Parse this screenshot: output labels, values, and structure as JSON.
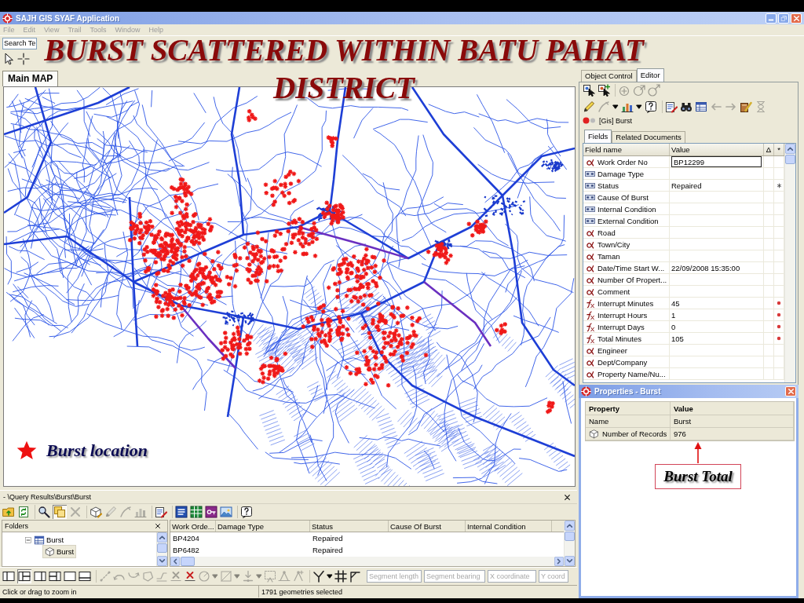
{
  "window": {
    "title": "SAJH GIS SYAF Application"
  },
  "menu": [
    "File",
    "Edit",
    "View",
    "Trail",
    "Tools",
    "Window",
    "Help"
  ],
  "toolbar": {
    "search": {
      "value": "Search Te"
    }
  },
  "slide_title": [
    "BURST SCATTERED WITHIN BATU PAHAT",
    "DISTRICT"
  ],
  "map_tabs": [
    {
      "label": "Main MAP",
      "selected": true
    }
  ],
  "map": {
    "legend": {
      "label": "Burst location"
    }
  },
  "side_panel": {
    "tabs": [
      {
        "label": "Object Control",
        "selected": false
      },
      {
        "label": "Editor",
        "selected": true
      }
    ],
    "toolbar_top": [
      [
        {
          "kind": "select",
          "disabled": false
        },
        {
          "kind": "select-add",
          "disabled": false
        }
      ],
      [
        {
          "kind": "point-add",
          "disabled": true
        },
        {
          "kind": "vertex-move",
          "disabled": true
        },
        {
          "kind": "node-link",
          "disabled": true
        }
      ]
    ],
    "toolbar_edit": [
      [
        {
          "kind": "pencil",
          "disabled": false
        },
        {
          "kind": "pen",
          "disabled": true
        },
        {
          "kind": "caret",
          "disabled": false
        },
        {
          "kind": "bar-chart",
          "disabled": false
        },
        {
          "kind": "caret",
          "disabled": false
        },
        {
          "kind": "help",
          "disabled": false
        }
      ],
      [
        {
          "kind": "form-edit",
          "disabled": false
        },
        {
          "kind": "binoculars",
          "disabled": false
        },
        {
          "kind": "table",
          "disabled": false
        },
        {
          "kind": "arrow-left",
          "disabled": true
        },
        {
          "kind": "arrow-right",
          "disabled": true
        },
        {
          "kind": "book-edit",
          "disabled": false
        },
        {
          "kind": "hourglass",
          "disabled": true
        }
      ]
    ],
    "layer": {
      "label": "[Gis] Burst",
      "active": true
    },
    "subtabs": [
      {
        "label": "Fields",
        "selected": true
      },
      {
        "label": "Related Documents",
        "selected": false
      }
    ],
    "columns": [
      "Field name",
      "Value",
      "Δ",
      "*"
    ],
    "rows": [
      {
        "kind": "text",
        "name": "Work Order No",
        "value": "BP12299",
        "editing": true,
        "required": false,
        "calculated": false
      },
      {
        "kind": "list",
        "name": "Damage Type",
        "editing": false,
        "required": false,
        "calculated": false
      },
      {
        "kind": "list",
        "name": "Status",
        "value": "Repaired",
        "editing": false,
        "required": true,
        "calculated": false
      },
      {
        "kind": "list",
        "name": "Cause Of Burst",
        "editing": false,
        "required": false,
        "calculated": false
      },
      {
        "kind": "list",
        "name": "Internal Condition",
        "editing": false,
        "required": false,
        "calculated": false
      },
      {
        "kind": "list",
        "name": "External Condition",
        "editing": false,
        "required": false,
        "calculated": false
      },
      {
        "kind": "text",
        "name": "Road",
        "editing": false,
        "required": false,
        "calculated": false
      },
      {
        "kind": "text",
        "name": "Town/City",
        "editing": false,
        "required": false,
        "calculated": false
      },
      {
        "kind": "text",
        "name": "Taman",
        "editing": false,
        "required": false,
        "calculated": false
      },
      {
        "kind": "text",
        "name": "Date/Time Start W...",
        "value": "22/09/2008 15:35:00",
        "editing": false,
        "required": false,
        "calculated": false
      },
      {
        "kind": "text",
        "name": "Number Of Propert...",
        "editing": false,
        "required": false,
        "calculated": false
      },
      {
        "kind": "text",
        "name": "Comment",
        "editing": false,
        "required": false,
        "calculated": false
      },
      {
        "kind": "formula",
        "name": "Interrupt Minutes",
        "value": "45",
        "editing": false,
        "required": false,
        "calculated": true
      },
      {
        "kind": "formula",
        "name": "Interrupt Hours",
        "value": "1",
        "editing": false,
        "required": false,
        "calculated": true
      },
      {
        "kind": "formula",
        "name": "Interrupt Days",
        "value": "0",
        "editing": false,
        "required": false,
        "calculated": true
      },
      {
        "kind": "formula",
        "name": "Total Minutes",
        "value": "105",
        "editing": false,
        "required": false,
        "calculated": true
      },
      {
        "kind": "text",
        "name": "Engineer",
        "editing": false,
        "required": false,
        "calculated": false
      },
      {
        "kind": "text",
        "name": "Dept/Company",
        "editing": false,
        "required": false,
        "calculated": false
      },
      {
        "kind": "text",
        "name": "Property Name/Nu...",
        "editing": false,
        "required": false,
        "calculated": false
      }
    ]
  },
  "properties": {
    "title": "Properties - Burst",
    "columns": [
      "Property",
      "Value"
    ],
    "rows": [
      {
        "kind": "plain",
        "name": "Name",
        "value": "Burst"
      },
      {
        "kind": "count",
        "name": "Number of Records",
        "value": "976"
      }
    ],
    "callout": "Burst Total"
  },
  "query_results": {
    "path": "- \\Query Results\\Burst\\Burst",
    "toolbar": [
      [
        {
          "kind": "folder-up",
          "pressed": false,
          "disabled": false
        },
        {
          "kind": "refresh",
          "pressed": false,
          "disabled": false
        }
      ],
      [
        {
          "kind": "search",
          "pressed": false,
          "disabled": false
        },
        {
          "kind": "copy",
          "pressed": true,
          "disabled": false
        },
        {
          "kind": "delete",
          "pressed": false,
          "disabled": true
        }
      ],
      [
        {
          "kind": "cube-edit",
          "pressed": false,
          "disabled": false
        },
        {
          "kind": "pencil",
          "pressed": false,
          "disabled": true
        },
        {
          "kind": "pen",
          "pressed": false,
          "disabled": true
        },
        {
          "kind": "bar-chart",
          "pressed": false,
          "disabled": true
        }
      ],
      [
        {
          "kind": "form-edit",
          "pressed": false,
          "disabled": false
        }
      ],
      [
        {
          "kind": "document",
          "pressed": false,
          "disabled": false
        },
        {
          "kind": "spreadsheet",
          "pressed": false,
          "disabled": false
        },
        {
          "kind": "database",
          "pressed": false,
          "disabled": false
        },
        {
          "kind": "picture",
          "pressed": false,
          "disabled": false
        }
      ],
      [
        {
          "kind": "help",
          "pressed": false,
          "disabled": false
        }
      ]
    ],
    "folders": {
      "title": "Folders",
      "tree": [
        {
          "kind": "table",
          "label": "Burst",
          "expanded": true,
          "selected": false,
          "children": [
            {
              "kind": "layer",
              "label": "Burst",
              "selected": true
            }
          ]
        }
      ]
    },
    "columns": [
      "Work Orde...",
      "Damage Type",
      "Status",
      "Cause Of Burst",
      "Internal Condition"
    ],
    "rows": [
      {
        "work_order": "BP4204",
        "status": "Repaired"
      },
      {
        "work_order": "BP6482",
        "status": "Repaired"
      }
    ]
  },
  "edit_bar": {
    "layouts": [
      {
        "kind": "split-left",
        "pressed": false
      },
      {
        "kind": "split-quad",
        "pressed": true
      },
      {
        "kind": "split-right",
        "pressed": false
      },
      {
        "kind": "split-columns",
        "pressed": false
      },
      {
        "kind": "single",
        "pressed": false
      },
      {
        "kind": "split-bottom",
        "pressed": false
      }
    ],
    "tools": [
      [
        {
          "kind": "dashed-line",
          "disabled": true
        },
        {
          "kind": "curve-left",
          "disabled": true
        },
        {
          "kind": "curve-right",
          "disabled": true
        },
        {
          "kind": "polygon",
          "disabled": true
        },
        {
          "kind": "trace",
          "disabled": true
        },
        {
          "kind": "vertex-delete",
          "disabled": true
        },
        {
          "kind": "vertex-delete",
          "disabled": false
        },
        {
          "kind": "circle",
          "disabled": true
        },
        {
          "kind": "caret",
          "disabled": true
        },
        {
          "kind": "square",
          "disabled": true
        },
        {
          "kind": "caret",
          "disabled": true
        },
        {
          "kind": "snap",
          "disabled": true
        },
        {
          "kind": "caret",
          "disabled": true
        },
        {
          "kind": "area-select",
          "disabled": true
        },
        {
          "kind": "vertex-pin",
          "disabled": true
        },
        {
          "kind": "vertex-pin-2",
          "disabled": true
        }
      ],
      [
        {
          "kind": "fork",
          "disabled": false
        },
        {
          "kind": "caret",
          "disabled": false
        },
        {
          "kind": "grid",
          "disabled": false
        },
        {
          "kind": "corner",
          "disabled": false
        }
      ]
    ],
    "fields": [
      {
        "placeholder": "Segment length"
      },
      {
        "placeholder": "Segment bearing"
      },
      {
        "placeholder": "X coordinate"
      },
      {
        "placeholder": "Y coord"
      }
    ]
  },
  "status_bar": {
    "hint": "Click or drag to zoom in",
    "selection": "1791 geometries selected"
  }
}
